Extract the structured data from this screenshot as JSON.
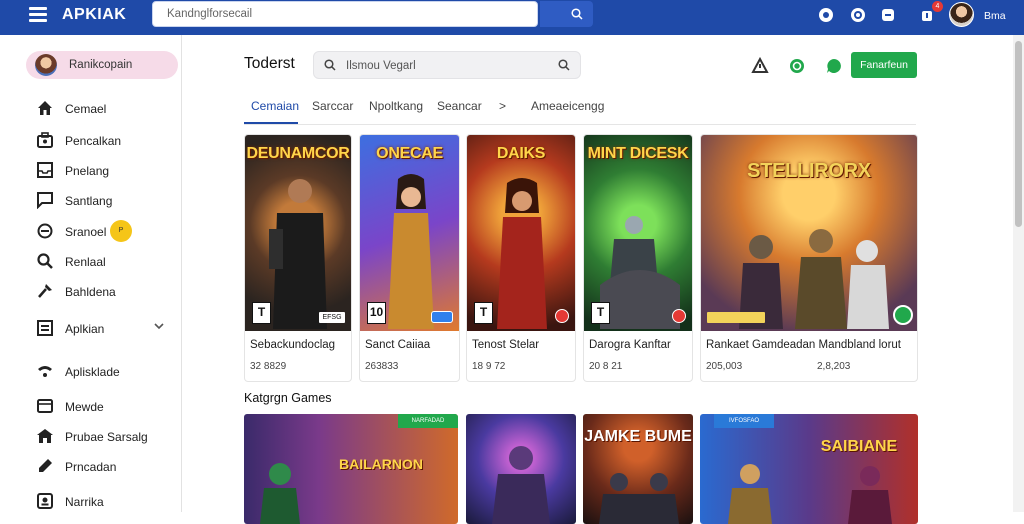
{
  "header": {
    "logo": "APKIAK",
    "search_placeholder": "Kandnglforsecail",
    "username": "Bma",
    "notification_count": "4",
    "icons": [
      "hamburger-icon",
      "search-icon",
      "circle-icon",
      "target-icon",
      "gamepad-icon",
      "bell-icon"
    ]
  },
  "sidebar": {
    "profile_name": "Ranikcopain",
    "items": [
      {
        "label": "Cemael",
        "icon": "home-icon"
      },
      {
        "label": "Pencalkan",
        "icon": "briefcase-icon"
      },
      {
        "label": "Pnelang",
        "icon": "inbox-icon"
      },
      {
        "label": "Santlang",
        "icon": "chat-icon"
      },
      {
        "label": "Sranoel",
        "icon": "link-icon",
        "badge": "P"
      },
      {
        "label": "Renlaal",
        "icon": "search-icon"
      },
      {
        "label": "Bahldena",
        "icon": "hammer-icon"
      },
      {
        "label": "Aplkian",
        "icon": "grid-icon"
      },
      {
        "label": "Aplisklade",
        "icon": "cloud-icon"
      },
      {
        "label": "Mewde",
        "icon": "window-icon"
      },
      {
        "label": "Prubae Sarsalg",
        "icon": "store-icon"
      },
      {
        "label": "Prncadan",
        "icon": "pen-icon"
      },
      {
        "label": "Narrika",
        "icon": "profile-icon"
      }
    ]
  },
  "main": {
    "title": "Toderst",
    "search_placeholder": "Ilsmou Vegarl",
    "action_label": "Fanarfeun",
    "tabs": [
      {
        "label": "Cemaian",
        "active": true
      },
      {
        "label": "Sarccar"
      },
      {
        "label": "Npoltkang"
      },
      {
        "label": "Seancar"
      },
      {
        "label": ">"
      },
      {
        "label": "Ameaeicengg"
      }
    ],
    "games": [
      {
        "cover_title": "DEUNAMCOR",
        "rating": "T",
        "publisher": "EFSG",
        "name": "Sebackundoclag",
        "count": "32 8829"
      },
      {
        "cover_title": "ONECAE",
        "rating": "10",
        "publisher": "",
        "name": "Sanct Caiiaa",
        "count": "263833"
      },
      {
        "cover_title": "DAIKS",
        "rating": "T",
        "publisher": "",
        "name": "Tenost Stelar",
        "count": "18 9 72"
      },
      {
        "cover_title": "MINT DICESK",
        "rating": "T",
        "publisher": "",
        "name": "Darogra Kanftar",
        "count": "20 8 21"
      },
      {
        "cover_title": "STELLIRORX",
        "rating": "",
        "publisher": "",
        "name": "Rankaet Gamdeadan Mandbland lorut",
        "count_a": "205,003",
        "count_b": "2,8,203"
      }
    ],
    "section_title": "Katgrgn Games",
    "category_cards": [
      {
        "title": "BAILARNON",
        "tag": "NARFADAD"
      },
      {
        "title": ""
      },
      {
        "title": "JAMKE BUME"
      },
      {
        "title": "SAIBIANE",
        "tag": "IVFOSFAO"
      }
    ]
  },
  "colors": {
    "brand": "#1f4aa8",
    "accent_green": "#21a84c",
    "profile_pill": "#f6dbe8",
    "badge_yellow": "#f5c518"
  }
}
